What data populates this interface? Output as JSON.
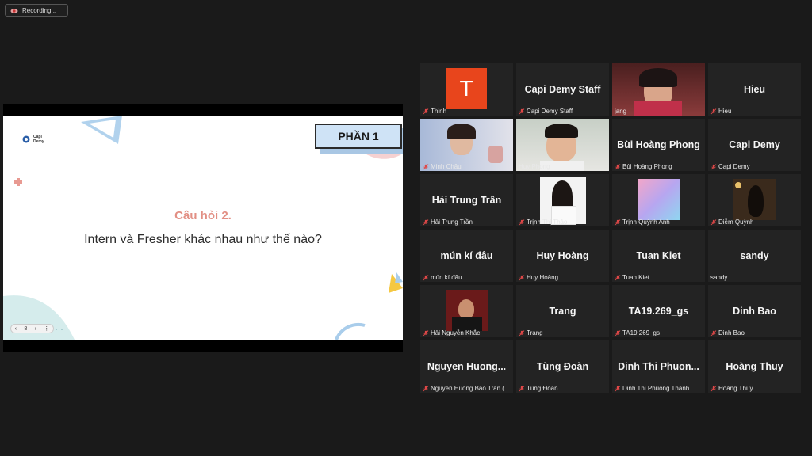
{
  "recording": {
    "label": "Recording..."
  },
  "slide": {
    "section": "PHẦN 1",
    "question_title": "Câu hỏi 2.",
    "question_text": "Intern và Fresher khác nhau như thế nào?",
    "logo_text": "Capi Demy",
    "page_number": "8",
    "accent": "#e28f84"
  },
  "participants": [
    {
      "display": "T",
      "label": "Thinh",
      "kind": "avatar",
      "muted": true
    },
    {
      "display": "Capi Demy Staff",
      "label": "Capi Demy Staff",
      "kind": "name",
      "muted": true
    },
    {
      "display": "",
      "label": "jang",
      "kind": "video",
      "muted": false
    },
    {
      "display": "Hieu",
      "label": "Hieu",
      "kind": "name",
      "muted": true
    },
    {
      "display": "",
      "label": "Minh Châu",
      "kind": "video",
      "muted": true
    },
    {
      "display": "",
      "label": "Huy Phong",
      "kind": "video",
      "muted": false,
      "active": true
    },
    {
      "display": "Bùi Hoàng Phong",
      "label": "Bùi Hoàng Phong",
      "kind": "name",
      "muted": true
    },
    {
      "display": "Capi Demy",
      "label": "Capi Demy",
      "kind": "name",
      "muted": true
    },
    {
      "display": "Hải Trung Trần",
      "label": "Hải Trung Trần",
      "kind": "name",
      "muted": true
    },
    {
      "display": "",
      "label": "Trịnh Thị Thảo",
      "kind": "photo",
      "muted": true
    },
    {
      "display": "",
      "label": "Trịnh Quỳnh Anh",
      "kind": "photo",
      "muted": true
    },
    {
      "display": "",
      "label": "Diễm Quỳnh",
      "kind": "photo",
      "muted": true
    },
    {
      "display": "mún kí đâu",
      "label": "mún kí đâu",
      "kind": "name",
      "muted": true
    },
    {
      "display": "Huy Hoàng",
      "label": "Huy Hoàng",
      "kind": "name",
      "muted": true
    },
    {
      "display": "Tuan Kiet",
      "label": "Tuan Kiet",
      "kind": "name",
      "muted": true
    },
    {
      "display": "sandy",
      "label": "sandy",
      "kind": "name",
      "muted": false
    },
    {
      "display": "",
      "label": "Hải Nguyễn Khắc",
      "kind": "photo",
      "muted": true
    },
    {
      "display": "Trang",
      "label": "Trang",
      "kind": "name",
      "muted": true
    },
    {
      "display": "TA19.269_gs",
      "label": "TA19.269_gs",
      "kind": "name",
      "muted": true
    },
    {
      "display": "Dinh Bao",
      "label": "Dinh Bao",
      "kind": "name",
      "muted": true
    },
    {
      "display": "Nguyen Huong...",
      "label": "Nguyen Huong Bao Tran (...",
      "kind": "name",
      "muted": true
    },
    {
      "display": "Tùng Đoàn",
      "label": "Tùng Đoàn",
      "kind": "name",
      "muted": true
    },
    {
      "display": "Dinh Thi Phuon...",
      "label": "Dinh Thi Phuong Thanh",
      "kind": "name",
      "muted": true
    },
    {
      "display": "Hoàng Thuy",
      "label": "Hoàng Thuy",
      "kind": "name",
      "muted": true
    }
  ]
}
